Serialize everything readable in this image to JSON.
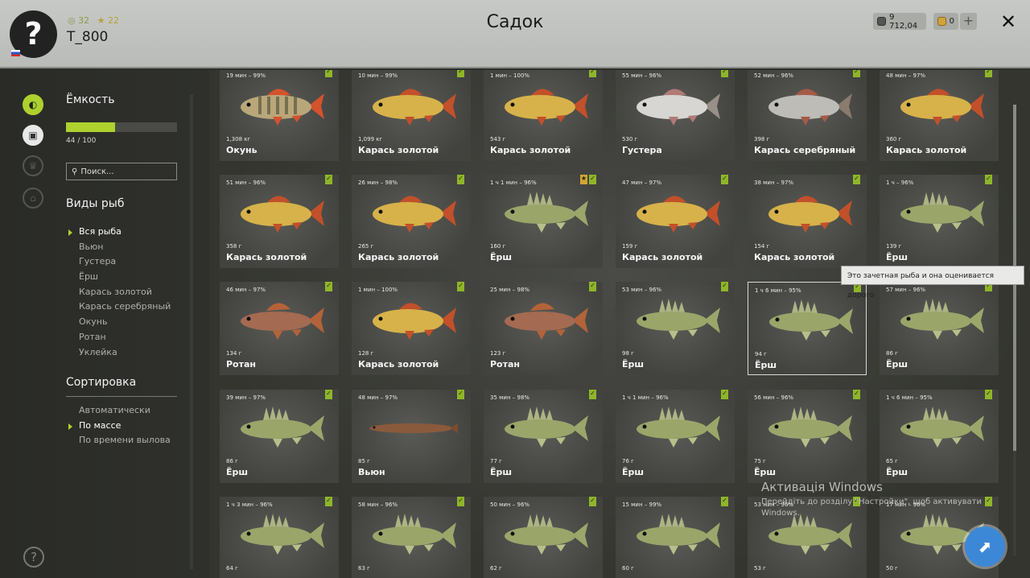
{
  "header": {
    "title": "Садок",
    "username": "T_800",
    "level": "32",
    "rank": "22",
    "silver": "9 712,04",
    "gold": "0",
    "plus_label": "+",
    "close_label": "✕",
    "avatar_glyph": "?"
  },
  "sidebar": {
    "capacity_title": "Ёмкость",
    "capacity_text": "44 / 100",
    "capacity_fraction": 0.44,
    "search_placeholder": "Поиск...",
    "species_title": "Виды рыб",
    "species": [
      "Вся рыба",
      "Вьюн",
      "Густера",
      "Ёрш",
      "Карась золотой",
      "Карась серебряный",
      "Окунь",
      "Ротан",
      "Уклейка"
    ],
    "species_selected": 0,
    "sort_title": "Сортировка",
    "sort_options": [
      "Автоматически",
      "По массе",
      "По времени вылова"
    ],
    "sort_selected": 1,
    "help_label": "?"
  },
  "tooltip": "Это зачетная рыба и она оценивается дорого",
  "windows_notice": {
    "line1": "Активація Windows",
    "line2": "Перейдіть до розділу \"Настройки\", щоб активувати",
    "line3": "Windows."
  },
  "colors": {
    "accent": "#aed12e",
    "gold_badge": "#d1a534"
  },
  "fish": [
    {
      "time": "19 мин – 99%",
      "weight": "1,308 кг",
      "name": "Окунь",
      "kind": "perch"
    },
    {
      "time": "10 мин – 99%",
      "weight": "1,099 кг",
      "name": "Карась золотой",
      "kind": "carp"
    },
    {
      "time": "1 мин – 100%",
      "weight": "543 г",
      "name": "Карась золотой",
      "kind": "carp"
    },
    {
      "time": "55 мин – 96%",
      "weight": "530 г",
      "name": "Густера",
      "kind": "bream"
    },
    {
      "time": "52 мин – 96%",
      "weight": "398 г",
      "name": "Карась серебряный",
      "kind": "silver"
    },
    {
      "time": "48 мин – 97%",
      "weight": "360 г",
      "name": "Карась золотой",
      "kind": "carp"
    },
    {
      "time": "51 мин – 96%",
      "weight": "358 г",
      "name": "Карась золотой",
      "kind": "carp"
    },
    {
      "time": "26 мин – 98%",
      "weight": "265 г",
      "name": "Карась золотой",
      "kind": "carp"
    },
    {
      "time": "1 ч 1 мин – 96%",
      "weight": "160 г",
      "name": "Ёрш",
      "kind": "ruffe",
      "gold": true
    },
    {
      "time": "47 мин – 97%",
      "weight": "159 г",
      "name": "Карась золотой",
      "kind": "carp"
    },
    {
      "time": "38 мин – 97%",
      "weight": "154 г",
      "name": "Карась золотой",
      "kind": "carp"
    },
    {
      "time": "1 ч – 96%",
      "weight": "139 г",
      "name": "Ёрш",
      "kind": "ruffe"
    },
    {
      "time": "46 мин – 97%",
      "weight": "134 г",
      "name": "Ротан",
      "kind": "rotan"
    },
    {
      "time": "1 мин – 100%",
      "weight": "128 г",
      "name": "Карась золотой",
      "kind": "carp"
    },
    {
      "time": "25 мин – 98%",
      "weight": "123 г",
      "name": "Ротан",
      "kind": "rotan"
    },
    {
      "time": "53 мин – 96%",
      "weight": "98 г",
      "name": "Ёрш",
      "kind": "ruffe"
    },
    {
      "time": "1 ч 6 мин – 95%",
      "weight": "94 г",
      "name": "Ёрш",
      "kind": "ruffe",
      "highlight": true
    },
    {
      "time": "57 мин – 96%",
      "weight": "86 г",
      "name": "Ёрш",
      "kind": "ruffe"
    },
    {
      "time": "39 мин – 97%",
      "weight": "86 г",
      "name": "Ёрш",
      "kind": "ruffe"
    },
    {
      "time": "48 мин – 97%",
      "weight": "85 г",
      "name": "Вьюн",
      "kind": "loach"
    },
    {
      "time": "35 мин – 98%",
      "weight": "77 г",
      "name": "Ёрш",
      "kind": "ruffe"
    },
    {
      "time": "1 ч 1 мин – 96%",
      "weight": "76 г",
      "name": "Ёрш",
      "kind": "ruffe"
    },
    {
      "time": "56 мин – 96%",
      "weight": "75 г",
      "name": "Ёрш",
      "kind": "ruffe"
    },
    {
      "time": "1 ч 6 мин – 95%",
      "weight": "65 г",
      "name": "Ёрш",
      "kind": "ruffe"
    },
    {
      "time": "1 ч 3 мин – 96%",
      "weight": "64 г",
      "name": "",
      "kind": "ruffe"
    },
    {
      "time": "58 мин – 96%",
      "weight": "63 г",
      "name": "",
      "kind": "ruffe"
    },
    {
      "time": "50 мин – 96%",
      "weight": "62 г",
      "name": "",
      "kind": "ruffe"
    },
    {
      "time": "15 мин – 99%",
      "weight": "60 г",
      "name": "",
      "kind": "ruffe"
    },
    {
      "time": "53 мин – 96%",
      "weight": "53 г",
      "name": "",
      "kind": "ruffe"
    },
    {
      "time": "17 мин – 96%",
      "weight": "50 г",
      "name": "",
      "kind": "ruffe"
    }
  ]
}
